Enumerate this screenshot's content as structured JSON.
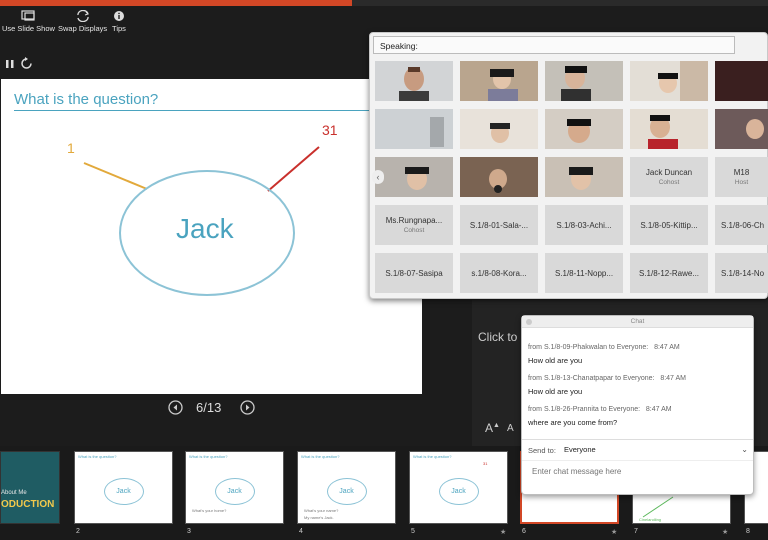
{
  "toolbar": {
    "use_slide_show": "Use Slide Show",
    "swap_displays": "Swap Displays",
    "tips": "Tips"
  },
  "slide": {
    "title": "What is the question?",
    "center_word": "Jack",
    "label_left": "1",
    "label_right": "31",
    "counter": "6/13"
  },
  "notes": {
    "text": "Click to"
  },
  "font_controls": {
    "increase": "A",
    "decrease": "A"
  },
  "thumbnails": [
    {
      "number": "",
      "title": "",
      "line1": "About Me",
      "line2": "ODUCTION",
      "word": ""
    },
    {
      "number": "2",
      "title": "What is the question?",
      "word": "Jack",
      "extra1": "",
      "extra2": ""
    },
    {
      "number": "3",
      "title": "What is the question?",
      "word": "Jack",
      "extra1": "What's your home?",
      "extra2": ""
    },
    {
      "number": "4",
      "title": "What is the question?",
      "word": "Jack",
      "extra1": "What's your name?",
      "extra2": "My name's Jack."
    },
    {
      "number": "5",
      "title": "What is the question?",
      "word": "Jack",
      "extra1": "",
      "extra2": "31"
    },
    {
      "number": "6",
      "title": "",
      "word": ""
    },
    {
      "number": "7",
      "title": "",
      "word": "",
      "extra1": "Cinelandling"
    },
    {
      "number": "8",
      "title": "",
      "word": ""
    }
  ],
  "zoom": {
    "speaking_label": "Speaking:",
    "participants": [
      {
        "name": "Jack Duncan",
        "role": "Cohost"
      },
      {
        "name": "M18",
        "role": "Host"
      },
      {
        "name": "Ms.Rungnapa...",
        "role": "Cohost"
      },
      {
        "name": "S.1/8-01-Sala-...",
        "role": ""
      },
      {
        "name": "S.1/8-03-Achi...",
        "role": ""
      },
      {
        "name": "S.1/8-05-Kittip...",
        "role": ""
      },
      {
        "name": "S.1/8-06-Ch",
        "role": ""
      },
      {
        "name": "S.1/8-07-Sasipa",
        "role": ""
      },
      {
        "name": "s.1/8-08-Kora...",
        "role": ""
      },
      {
        "name": "S.1/8-11-Nopp...",
        "role": ""
      },
      {
        "name": "S.1/8-12-Rawe...",
        "role": ""
      },
      {
        "name": "S.1/8-14-No",
        "role": ""
      }
    ]
  },
  "chat": {
    "header": "Chat",
    "messages": [
      {
        "from": "from S.1/8-09-Phakwalan to Everyone:",
        "time": "8:47  AM",
        "text": "How old are you"
      },
      {
        "from": "from S.1/8-13-Chanatpapar to Everyone:",
        "time": "8:47  AM",
        "text": "How old are you"
      },
      {
        "from": "from S.1/8-26-Prannita to Everyone:",
        "time": "8:47  AM",
        "text": "where are you come from?"
      }
    ],
    "send_to_label": "Send to:",
    "send_to_value": "Everyone",
    "input_placeholder": "Enter chat message here"
  }
}
